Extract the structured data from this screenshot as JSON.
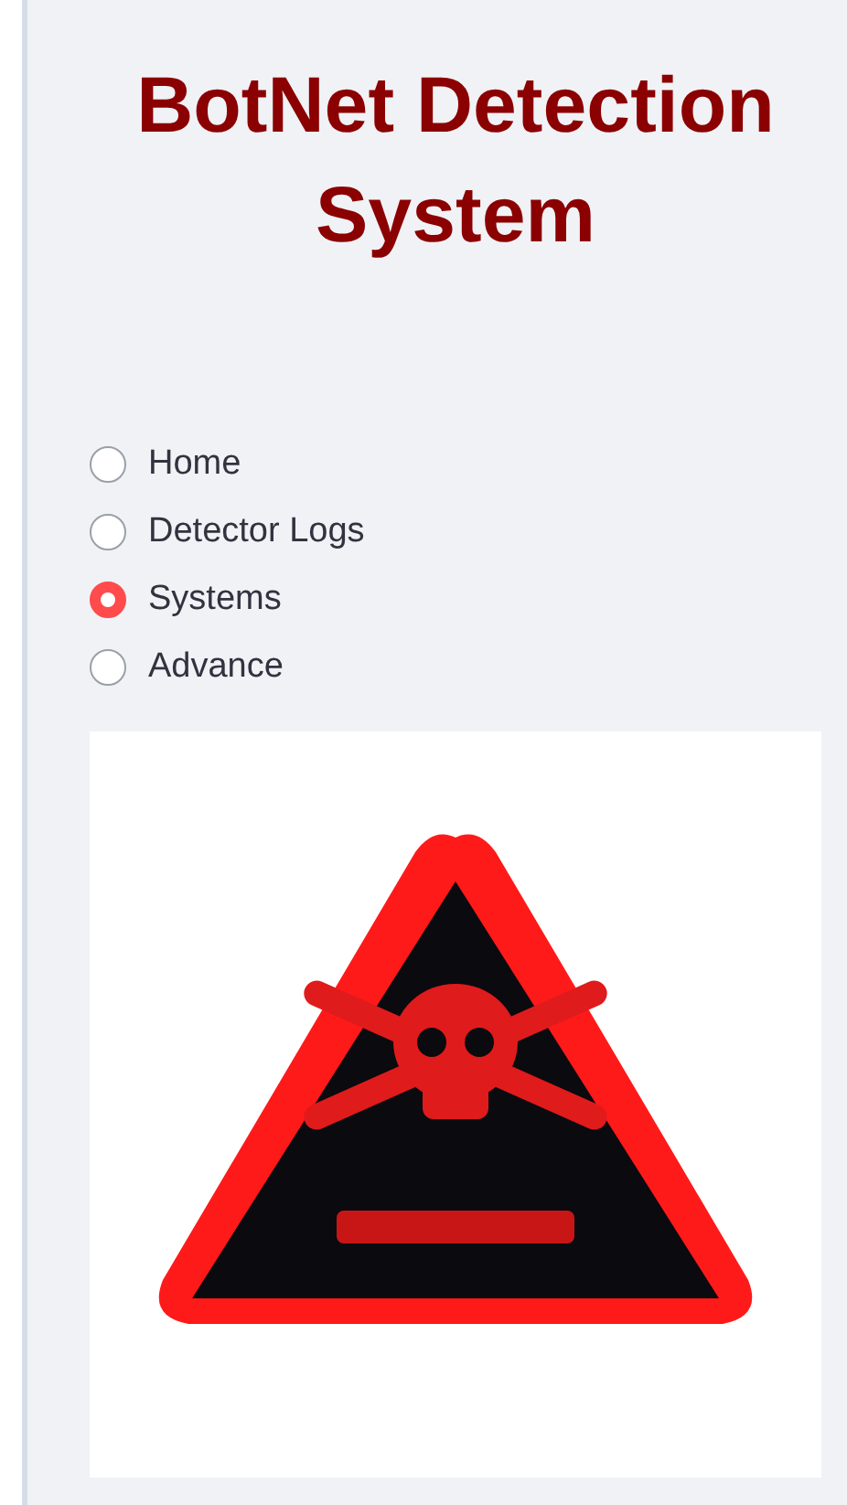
{
  "title": "BotNet Detection System",
  "navigation": [
    {
      "label": "Home",
      "selected": false
    },
    {
      "label": "Detector Logs",
      "selected": false
    },
    {
      "label": "Systems",
      "selected": true
    },
    {
      "label": "Advance",
      "selected": false
    }
  ]
}
